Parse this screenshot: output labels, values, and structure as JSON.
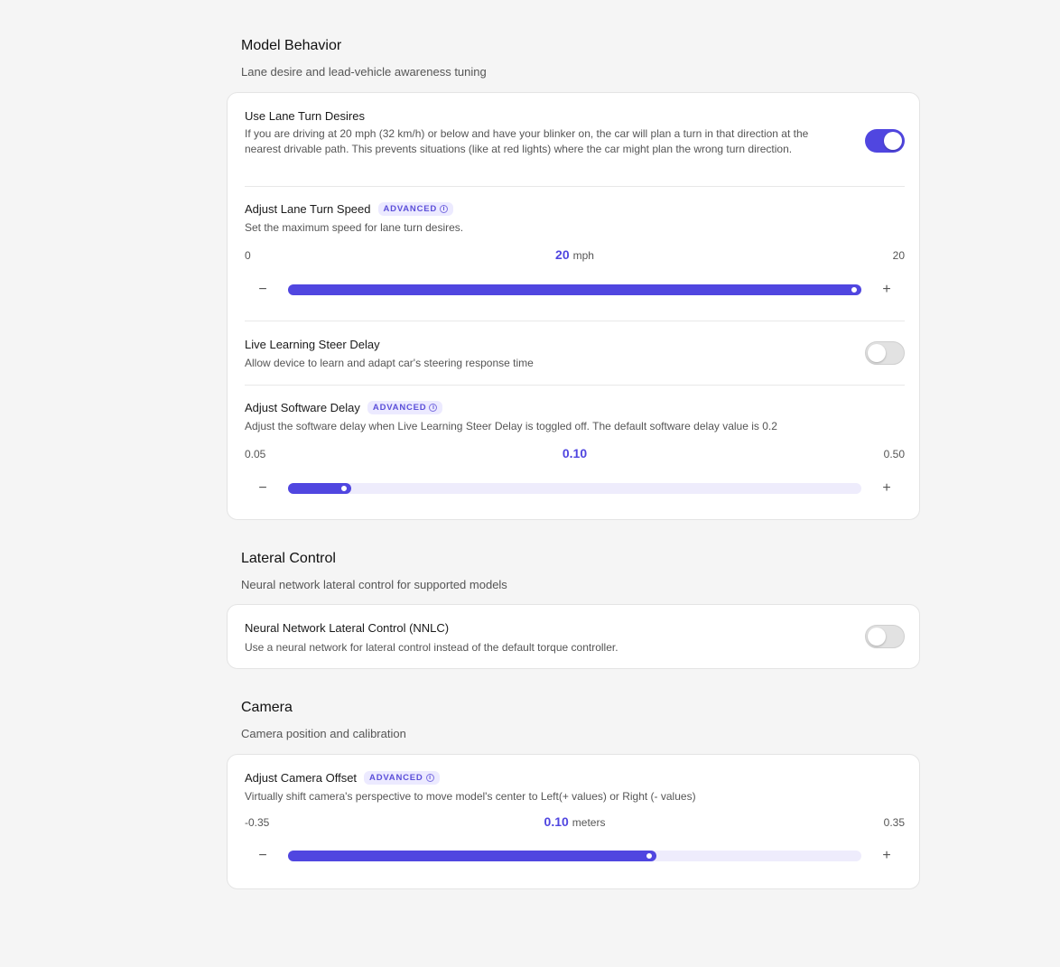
{
  "sections": [
    {
      "title": "Model Behavior",
      "subtitle": "Lane desire and lead-vehicle awareness tuning",
      "settings": [
        {
          "title": "Use Lane Turn Desires",
          "description": "If you are driving at 20 mph (32 km/h) or below and have your blinker on, the car will plan a turn in that direction at the nearest drivable path. This prevents situations (like at red lights) where the car might plan the wrong turn direction.",
          "toggle": true
        },
        {
          "title": "Adjust Lane Turn Speed",
          "badge": "ADVANCED",
          "description": "Set the maximum speed for lane turn desires.",
          "slider": {
            "min": "0",
            "max": "20",
            "value": "20",
            "unit": "mph",
            "fraction": 1.0
          }
        },
        {
          "title": "Live Learning Steer Delay",
          "description": "Allow device to learn and adapt car's steering response time",
          "toggle": false
        },
        {
          "title": "Adjust Software Delay",
          "badge": "ADVANCED",
          "description": "Adjust the software delay when Live Learning Steer Delay is toggled off. The default software delay value is 0.2",
          "slider": {
            "min": "0.05",
            "max": "0.50",
            "value": "0.10",
            "unit": "",
            "fraction": 0.111
          }
        }
      ]
    },
    {
      "title": "Lateral Control",
      "subtitle": "Neural network lateral control for supported models",
      "settings": [
        {
          "title": "Neural Network Lateral Control (NNLC)",
          "description": "Use a neural network for lateral control instead of the default torque controller.",
          "toggle": false
        }
      ]
    },
    {
      "title": "Camera",
      "subtitle": "Camera position and calibration",
      "settings": [
        {
          "title": "Adjust Camera Offset",
          "badge": "ADVANCED",
          "description": "Virtually shift camera's perspective to move model's center to Left(+ values) or Right (- values)",
          "slider": {
            "min": "-0.35",
            "max": "0.35",
            "value": "0.10",
            "unit": "meters",
            "fraction": 0.643
          }
        }
      ]
    }
  ],
  "icons": {
    "minus": "minus-icon",
    "plus": "plus-icon",
    "info": "info-icon"
  },
  "symbols": {
    "minus": "−",
    "plus": "+",
    "info": "i"
  },
  "colors": {
    "accent": "#5046e0",
    "badge_bg": "#eceaff",
    "track_bg": "#eeecfc"
  }
}
